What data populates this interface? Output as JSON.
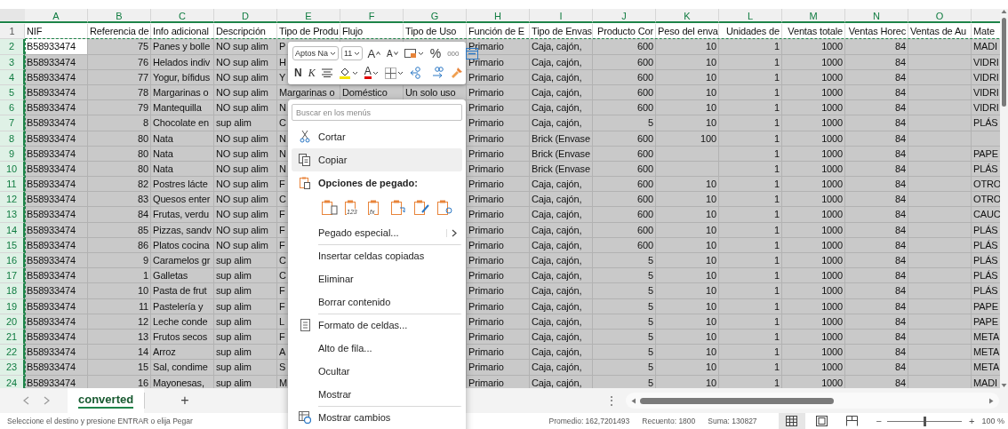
{
  "sheet": {
    "columns": [
      {
        "letter": "A",
        "kind": "text"
      },
      {
        "letter": "B",
        "kind": "number"
      },
      {
        "letter": "C",
        "kind": "text"
      },
      {
        "letter": "D",
        "kind": "text"
      },
      {
        "letter": "E",
        "kind": "text"
      },
      {
        "letter": "F",
        "kind": "text"
      },
      {
        "letter": "G",
        "kind": "text"
      },
      {
        "letter": "H",
        "kind": "text"
      },
      {
        "letter": "I",
        "kind": "text"
      },
      {
        "letter": "J",
        "kind": "number"
      },
      {
        "letter": "K",
        "kind": "number"
      },
      {
        "letter": "L",
        "kind": "number"
      },
      {
        "letter": "M",
        "kind": "number"
      },
      {
        "letter": "N",
        "kind": "number"
      },
      {
        "letter": "O",
        "kind": "text"
      },
      {
        "kind": "text"
      }
    ],
    "rows": [
      {
        "number": "1",
        "selected": false,
        "active": false,
        "cells": [
          "NIF",
          "Referencia de",
          "Info adicional",
          "Descripción",
          "Tipo de Produ",
          "Flujo",
          "Tipo de Uso",
          "Función de E",
          "Tipo de Envas",
          "Producto Cor",
          "Peso del enva",
          "Unidades de",
          "Ventas totale",
          "Ventas Horec",
          "Ventas de Au",
          "Mate"
        ]
      },
      {
        "number": "2",
        "selected": true,
        "active": true,
        "cells": [
          "B58933474",
          "75",
          "Panes y bolle",
          "NO sup alim",
          "P",
          "",
          "",
          "Primario",
          "Caja, cajón,",
          "600",
          "10",
          "1",
          "1000",
          "84",
          "",
          "MADI"
        ]
      },
      {
        "number": "3",
        "selected": true,
        "active": false,
        "cells": [
          "B58933474",
          "76",
          "Helados indiv",
          "NO sup alim",
          "H",
          "",
          "",
          "Primario",
          "Caja, cajón,",
          "600",
          "10",
          "1",
          "1000",
          "84",
          "",
          "VIDRI"
        ]
      },
      {
        "number": "4",
        "selected": true,
        "active": false,
        "cells": [
          "B58933474",
          "77",
          "Yogur, bífidus",
          "NO sup alim",
          "Y",
          "",
          "",
          "Primario",
          "Caja, cajón,",
          "600",
          "10",
          "1",
          "1000",
          "84",
          "",
          "VIDRI"
        ]
      },
      {
        "number": "5",
        "selected": true,
        "active": false,
        "cells": [
          "B58933474",
          "78",
          "Margarinas o",
          "NO sup alim",
          "Margarinas o",
          "Doméstico",
          "Un solo uso",
          "Primario",
          "Caja, cajón,",
          "600",
          "10",
          "1",
          "1000",
          "84",
          "",
          "VIDRI"
        ]
      },
      {
        "number": "6",
        "selected": true,
        "active": false,
        "cells": [
          "B58933474",
          "79",
          "Mantequilla",
          "NO sup alim",
          "N",
          "",
          "",
          "Primario",
          "Caja, cajón,",
          "600",
          "10",
          "1",
          "1000",
          "84",
          "",
          "VIDRI"
        ]
      },
      {
        "number": "7",
        "selected": true,
        "active": false,
        "cells": [
          "B58933474",
          "8",
          "Chocolate en",
          "sup alim",
          "C",
          "",
          "",
          "Primario",
          "Caja, cajón,",
          "5",
          "10",
          "1",
          "1000",
          "84",
          "",
          "PLÁS"
        ]
      },
      {
        "number": "8",
        "selected": true,
        "active": false,
        "cells": [
          "B58933474",
          "80",
          "Nata",
          "NO sup alim",
          "N",
          "",
          "",
          "Primario",
          "Brick (Envase",
          "600",
          "100",
          "1",
          "1000",
          "84",
          "",
          ""
        ]
      },
      {
        "number": "9",
        "selected": true,
        "active": false,
        "cells": [
          "B58933474",
          "80",
          "Nata",
          "NO sup alim",
          "N",
          "",
          "",
          "Primario",
          "Brick (Envase",
          "600",
          "",
          "1",
          "1000",
          "84",
          "",
          "PAPE"
        ]
      },
      {
        "number": "10",
        "selected": true,
        "active": false,
        "cells": [
          "B58933474",
          "80",
          "Nata",
          "NO sup alim",
          "N",
          "",
          "",
          "Primario",
          "Brick (Envase",
          "600",
          "",
          "1",
          "1000",
          "84",
          "",
          "PLÁS"
        ]
      },
      {
        "number": "11",
        "selected": true,
        "active": false,
        "cells": [
          "B58933474",
          "82",
          "Postres lácte",
          "NO sup alim",
          "F",
          "",
          "",
          "Primario",
          "Caja, cajón,",
          "600",
          "10",
          "1",
          "1000",
          "84",
          "",
          "OTRO"
        ]
      },
      {
        "number": "12",
        "selected": true,
        "active": false,
        "cells": [
          "B58933474",
          "83",
          "Quesos enter",
          "NO sup alim",
          "C",
          "",
          "",
          "Primario",
          "Caja, cajón,",
          "600",
          "10",
          "1",
          "1000",
          "84",
          "",
          "OTRO"
        ]
      },
      {
        "number": "13",
        "selected": true,
        "active": false,
        "cells": [
          "B58933474",
          "84",
          "Frutas, verdu",
          "NO sup alim",
          "F",
          "",
          "",
          "Primario",
          "Caja, cajón,",
          "600",
          "10",
          "1",
          "1000",
          "84",
          "",
          "CAUC"
        ]
      },
      {
        "number": "14",
        "selected": true,
        "active": false,
        "cells": [
          "B58933474",
          "85",
          "Pizzas, sandv",
          "NO sup alim",
          "F",
          "",
          "",
          "Primario",
          "Caja, cajón,",
          "600",
          "10",
          "1",
          "1000",
          "84",
          "",
          "PLÁS"
        ]
      },
      {
        "number": "15",
        "selected": true,
        "active": false,
        "cells": [
          "B58933474",
          "86",
          "Platos cocina",
          "NO sup alim",
          "F",
          "",
          "",
          "Primario",
          "Caja, cajón,",
          "600",
          "10",
          "1",
          "1000",
          "84",
          "",
          "PLÁS"
        ]
      },
      {
        "number": "16",
        "selected": true,
        "active": false,
        "cells": [
          "B58933474",
          "9",
          "Caramelos gr",
          "sup alim",
          "C",
          "",
          "",
          "Primario",
          "Caja, cajón,",
          "5",
          "10",
          "1",
          "1000",
          "84",
          "",
          "PLÁS"
        ]
      },
      {
        "number": "17",
        "selected": true,
        "active": false,
        "cells": [
          "B58933474",
          "1",
          "Galletas",
          "sup alim",
          "C",
          "",
          "",
          "Primario",
          "Caja, cajón,",
          "5",
          "10",
          "1",
          "1000",
          "84",
          "",
          "PLÁS"
        ]
      },
      {
        "number": "18",
        "selected": true,
        "active": false,
        "cells": [
          "B58933474",
          "10",
          "Pasta de frut",
          "sup alim",
          "F",
          "",
          "",
          "Primario",
          "Caja, cajón,",
          "5",
          "10",
          "1",
          "1000",
          "84",
          "",
          "PLÁS"
        ]
      },
      {
        "number": "19",
        "selected": true,
        "active": false,
        "cells": [
          "B58933474",
          "11",
          "Pastelería y",
          "sup alim",
          "F",
          "",
          "",
          "Primario",
          "Caja, cajón,",
          "5",
          "10",
          "1",
          "1000",
          "84",
          "",
          "PAPE"
        ]
      },
      {
        "number": "20",
        "selected": true,
        "active": false,
        "cells": [
          "B58933474",
          "12",
          "Leche conde",
          "sup alim",
          "L",
          "",
          "",
          "Primario",
          "Caja, cajón,",
          "5",
          "10",
          "1",
          "1000",
          "84",
          "",
          "PAPE"
        ]
      },
      {
        "number": "21",
        "selected": true,
        "active": false,
        "cells": [
          "B58933474",
          "13",
          "Frutos secos",
          "sup alim",
          "F",
          "",
          "",
          "Primario",
          "Caja, cajón,",
          "5",
          "10",
          "1",
          "1000",
          "84",
          "",
          "META"
        ]
      },
      {
        "number": "22",
        "selected": true,
        "active": false,
        "cells": [
          "B58933474",
          "14",
          "Arroz",
          "sup alim",
          "A",
          "",
          "",
          "Primario",
          "Caja, cajón,",
          "5",
          "10",
          "1",
          "1000",
          "84",
          "",
          "META"
        ]
      },
      {
        "number": "23",
        "selected": true,
        "active": false,
        "cells": [
          "B58933474",
          "15",
          "Sal, condime",
          "sup alim",
          "S",
          "",
          "",
          "Primario",
          "Caja, cajón,",
          "5",
          "10",
          "1",
          "1000",
          "84",
          "",
          "META"
        ]
      },
      {
        "number": "24",
        "selected": true,
        "active": false,
        "cells": [
          "B58933474",
          "16",
          "Mayonesas,",
          "sup alim",
          "M",
          "",
          "",
          "Primario",
          "Caja, cajón,",
          "5",
          "10",
          "1",
          "1000",
          "84",
          "",
          "MADI"
        ]
      }
    ]
  },
  "mini_toolbar": {
    "font": "Aptos Na",
    "size": "11",
    "rows": [
      {
        "buttons": [
          {
            "kind": "grow-font",
            "label": "A",
            "dropdown": false
          },
          {
            "kind": "shrink-font",
            "label": "A",
            "dropdown": false
          },
          {
            "kind": "number-format",
            "dropdown": true
          },
          {
            "kind": "percent",
            "label": "%",
            "dropdown": false
          },
          {
            "kind": "thousands",
            "label": "000",
            "dropdown": false
          },
          {
            "kind": "wrap",
            "dropdown": false
          }
        ]
      },
      {
        "buttons": [
          {
            "kind": "bold",
            "label": "N",
            "dropdown": false
          },
          {
            "kind": "italic",
            "label": "K",
            "dropdown": false
          },
          {
            "kind": "align",
            "dropdown": false
          },
          {
            "kind": "fill-color",
            "dropdown": true
          },
          {
            "kind": "font-color",
            "label": "A",
            "dropdown": true
          },
          {
            "kind": "borders",
            "dropdown": true
          },
          {
            "kind": "decrease-decimals",
            "dropdown": false
          },
          {
            "kind": "increase-decimals",
            "dropdown": false
          },
          {
            "kind": "format-painter",
            "dropdown": false
          }
        ]
      }
    ]
  },
  "context_menu": {
    "search": {
      "placeholder": "Buscar en los menús"
    },
    "items": [
      {
        "kind": "cut",
        "label": "Cortar",
        "selected": false,
        "submenu": false,
        "separator_before": false
      },
      {
        "kind": "copy",
        "label": "Copiar",
        "selected": true,
        "submenu": false,
        "separator_before": false
      },
      {
        "kind": "paste-header",
        "label": "Opciones de pegado:",
        "selected": false,
        "submenu": false,
        "separator_before": false
      },
      {
        "kind": "paste-options",
        "options": [
          {
            "kind": "paste"
          },
          {
            "kind": "values",
            "label": "123"
          },
          {
            "kind": "formulas",
            "label": "fx"
          },
          {
            "kind": "transpose"
          },
          {
            "kind": "formatting"
          },
          {
            "kind": "link"
          }
        ]
      },
      {
        "kind": "item",
        "label": "Pegado especial...",
        "selected": false,
        "submenu": true,
        "separator_before": false
      },
      {
        "kind": "item",
        "label": "Insertar celdas copiadas",
        "selected": false,
        "submenu": false,
        "separator_before": true
      },
      {
        "kind": "item",
        "label": "Eliminar",
        "selected": false,
        "submenu": false,
        "separator_before": false
      },
      {
        "kind": "item",
        "label": "Borrar contenido",
        "selected": false,
        "submenu": false,
        "separator_before": false
      },
      {
        "kind": "format-cells",
        "label": "Formato de celdas...",
        "selected": false,
        "submenu": false,
        "separator_before": true
      },
      {
        "kind": "item",
        "label": "Alto de fila...",
        "selected": false,
        "submenu": false,
        "separator_before": false
      },
      {
        "kind": "item",
        "label": "Ocultar",
        "selected": false,
        "submenu": false,
        "separator_before": false
      },
      {
        "kind": "item",
        "label": "Mostrar",
        "selected": false,
        "submenu": false,
        "separator_before": false
      },
      {
        "kind": "show-changes",
        "label": "Mostrar cambios",
        "selected": false,
        "submenu": false,
        "separator_before": true
      }
    ]
  },
  "sheet_tabs": {
    "tabs": [
      {
        "label": "converted",
        "selected": true
      }
    ],
    "add": "+",
    "more": "⋮"
  },
  "status_bar": {
    "message": "Seleccione el destino y presione ENTRAR o elija Pegar",
    "stats": [
      "Promedio: 162,7201493",
      "Recuento: 1800",
      "Suma: 130827"
    ],
    "views": [
      {
        "kind": "normal",
        "selected": true
      },
      {
        "kind": "page-layout",
        "selected": false
      },
      {
        "kind": "page-break",
        "selected": false
      }
    ],
    "zoom": {
      "minus": "−",
      "plus": "+",
      "level": 0.5,
      "reading": "100 %"
    }
  }
}
